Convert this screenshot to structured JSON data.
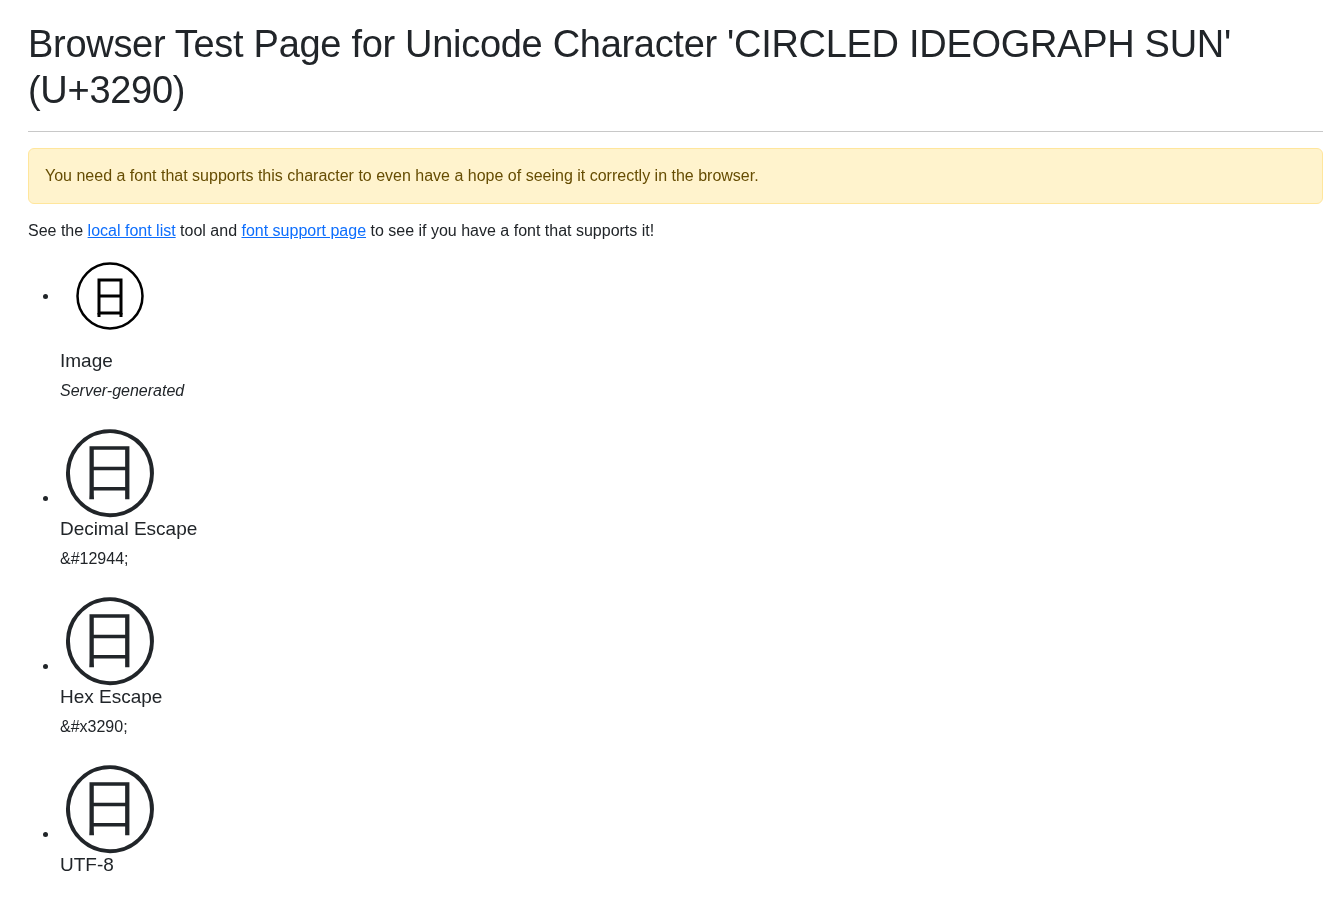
{
  "title": "Browser Test Page for Unicode Character 'CIRCLED IDEOGRAPH SUN' (U+3290)",
  "alert": "You need a font that supports this character to even have a hope of seeing it correctly in the browser.",
  "intro": {
    "before": "See the ",
    "link_1": "local font list",
    "middle": " tool and ",
    "link_2": "font support page",
    "after": " to see if you have a font that supports it!"
  },
  "items": [
    {
      "kind": "image",
      "label": "Image",
      "caption": "Server-generated"
    },
    {
      "kind": "glyph",
      "glyph": "㊐",
      "label": "Decimal Escape",
      "caption": "&#12944;"
    },
    {
      "kind": "glyph",
      "glyph": "㊐",
      "label": "Hex Escape",
      "caption": "&#x3290;"
    },
    {
      "kind": "glyph",
      "glyph": "㊐",
      "label": "UTF-8"
    }
  ]
}
